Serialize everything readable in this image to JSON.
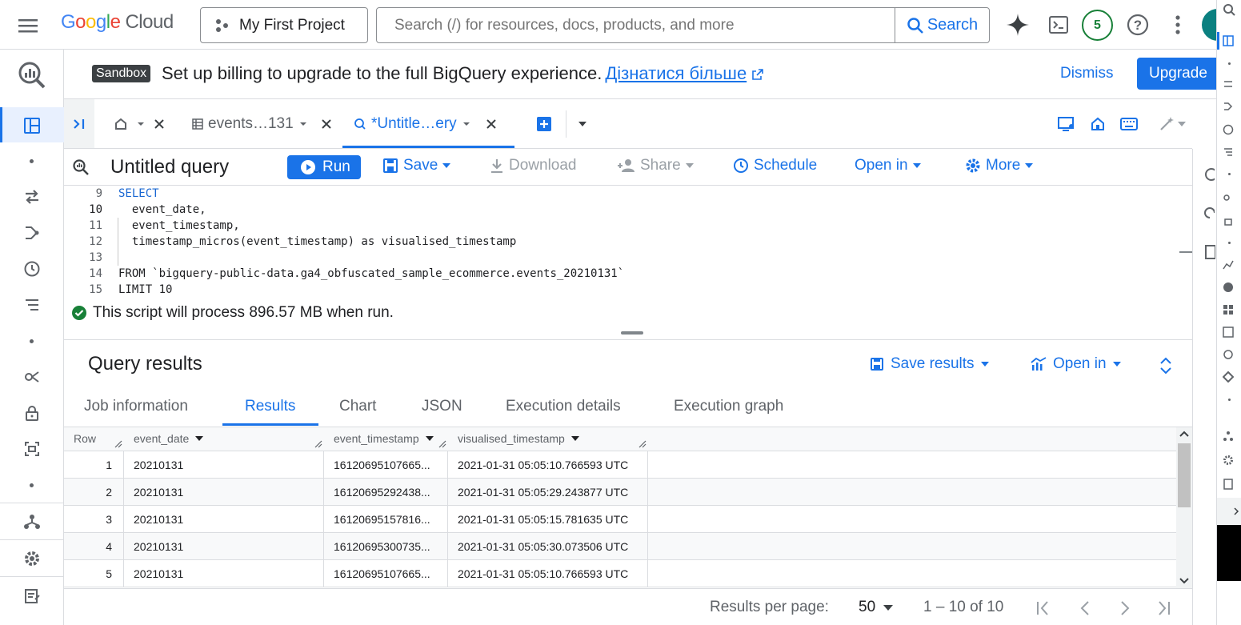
{
  "topbar": {
    "logo_google": [
      "G",
      "o",
      "o",
      "g",
      "l",
      "e"
    ],
    "logo_cloud": "Cloud",
    "project": "My First Project",
    "search_placeholder": "Search (/) for resources, docs, products, and more",
    "search_button": "Search",
    "notifications_count": "5"
  },
  "banner": {
    "badge": "Sandbox",
    "text": "Set up billing to upgrade to the full BigQuery experience.",
    "link": "Дізнатися більше",
    "dismiss": "Dismiss",
    "upgrade": "Upgrade"
  },
  "tabs": {
    "tab2": "events…131",
    "tab3": "*Untitle…ery"
  },
  "toolbar": {
    "title": "Untitled query",
    "run": "Run",
    "save": "Save",
    "download": "Download",
    "share": "Share",
    "schedule": "Schedule",
    "open_in": "Open in",
    "more": "More"
  },
  "editor": {
    "lines": [
      {
        "n": "9",
        "code": "SELECT"
      },
      {
        "n": "10",
        "code": "  event_date,"
      },
      {
        "n": "11",
        "code": "  event_timestamp,"
      },
      {
        "n": "12",
        "code": "  timestamp_micros(event_timestamp) as visualised_timestamp"
      },
      {
        "n": "13",
        "code": ""
      },
      {
        "n": "14",
        "code": "FROM `bigquery-public-data.ga4_obfuscated_sample_ecommerce.events_20210131`"
      },
      {
        "n": "15",
        "code": "LIMIT 10"
      }
    ]
  },
  "process_message": "This script will process 896.57 MB when run.",
  "results": {
    "title": "Query results",
    "save_results": "Save results",
    "open_in": "Open in",
    "tabs": [
      "Job information",
      "Results",
      "Chart",
      "JSON",
      "Execution details",
      "Execution graph"
    ],
    "active_tab": "Results",
    "columns": [
      "Row",
      "event_date",
      "event_timestamp",
      "visualised_timestamp"
    ],
    "rows": [
      [
        "1",
        "20210131",
        "16120695107665...",
        "2021-01-31 05:05:10.766593 UTC"
      ],
      [
        "2",
        "20210131",
        "16120695292438...",
        "2021-01-31 05:05:29.243877 UTC"
      ],
      [
        "3",
        "20210131",
        "16120695157816...",
        "2021-01-31 05:05:15.781635 UTC"
      ],
      [
        "4",
        "20210131",
        "16120695300735...",
        "2021-01-31 05:05:30.073506 UTC"
      ],
      [
        "5",
        "20210131",
        "16120695107665...",
        "2021-01-31 05:05:10.766593 UTC"
      ]
    ]
  },
  "pager": {
    "per_page_label": "Results per page:",
    "per_page_value": "50",
    "range": "1 – 10 of 10"
  },
  "colors": {
    "accent": "#1a73e8",
    "success": "#188038"
  }
}
